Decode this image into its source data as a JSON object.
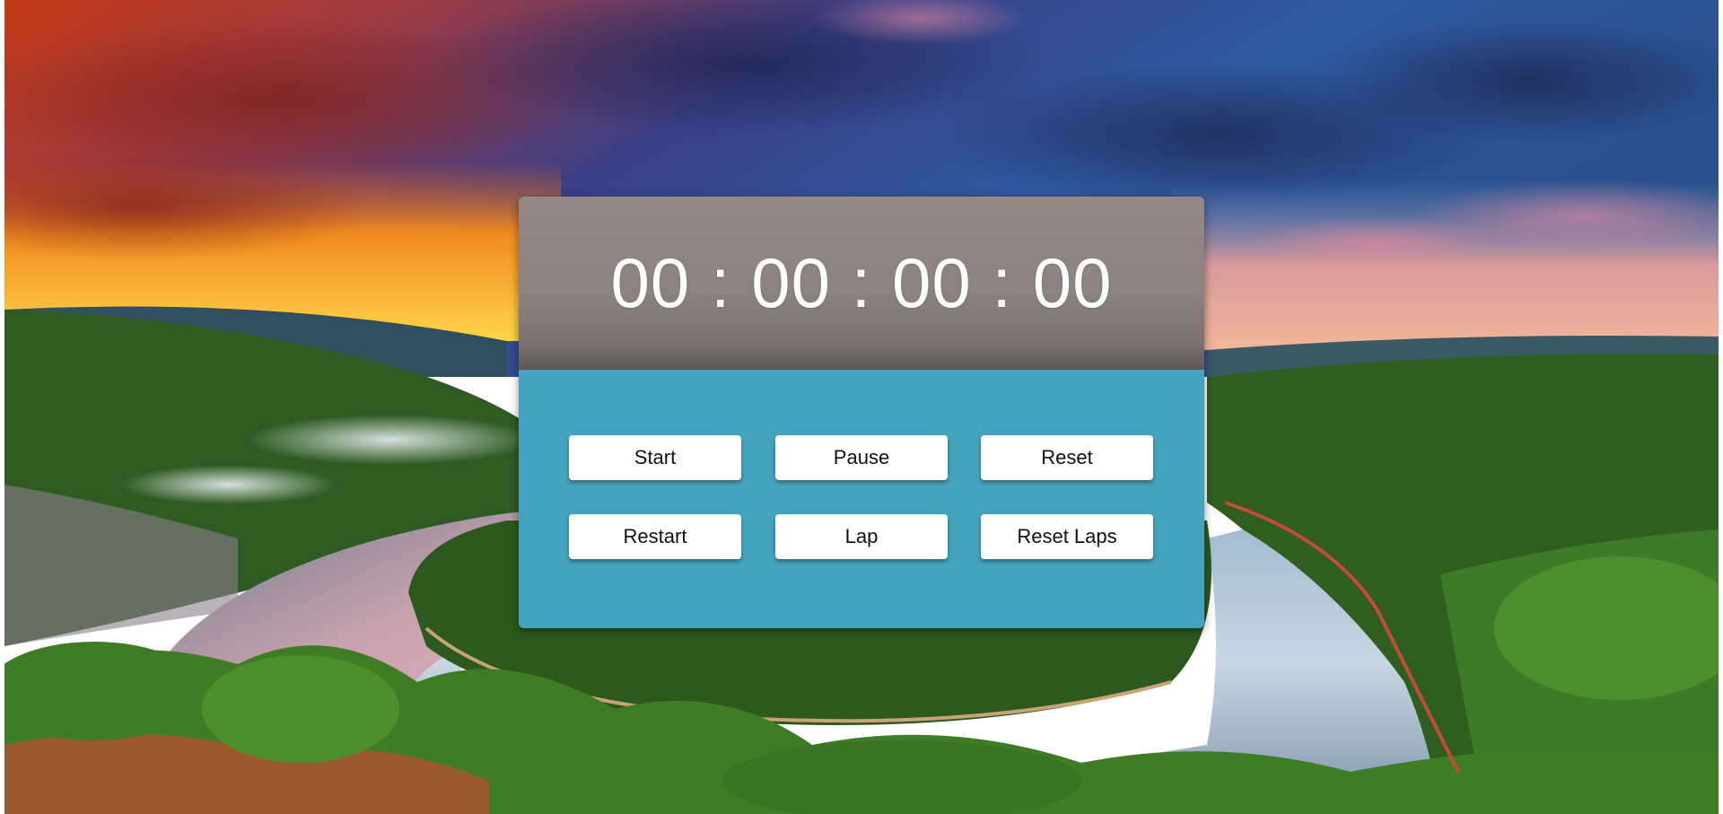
{
  "stopwatch": {
    "time": "00 : 00 : 00 : 00"
  },
  "controls": {
    "start_label": "Start",
    "pause_label": "Pause",
    "reset_label": "Reset",
    "restart_label": "Restart",
    "lap_label": "Lap",
    "reset_laps_label": "Reset Laps"
  },
  "colors": {
    "display_background": "#8c8281",
    "controls_background": "#44a4bd",
    "button_background": "#ffffff",
    "time_text": "#ffffff"
  }
}
